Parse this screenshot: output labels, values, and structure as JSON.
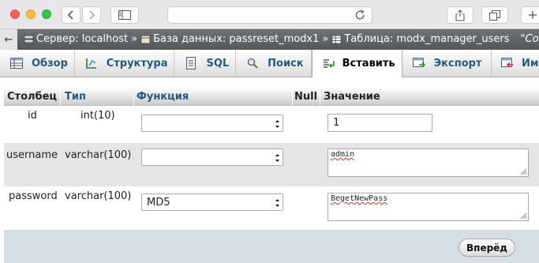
{
  "breadcrumb": {
    "server": "Сервер: localhost",
    "database": "База данных: passreset_modx1",
    "table": "Таблица: modx_manager_users",
    "extra": "\"Co"
  },
  "tabs": [
    {
      "label": "Обзор",
      "icon": "browse-icon"
    },
    {
      "label": "Структура",
      "icon": "structure-icon"
    },
    {
      "label": "SQL",
      "icon": "sql-icon"
    },
    {
      "label": "Поиск",
      "icon": "search-icon"
    },
    {
      "label": "Вставить",
      "icon": "insert-icon",
      "active": true
    },
    {
      "label": "Экспорт",
      "icon": "export-icon"
    },
    {
      "label": "Им",
      "icon": "import-icon"
    }
  ],
  "table": {
    "headers": {
      "column": "Столбец",
      "type": "Тип",
      "function": "Функция",
      "null": "Null",
      "value": "Значение"
    },
    "rows": [
      {
        "name": "id",
        "type": "int(10)",
        "function": "",
        "value": "1"
      },
      {
        "name": "username",
        "type": "varchar(100)",
        "function": "",
        "value": "admin"
      },
      {
        "name": "password",
        "type": "varchar(100)",
        "function": "MD5",
        "value": "BegetNewPass"
      }
    ]
  },
  "go_button": "Вперёд"
}
